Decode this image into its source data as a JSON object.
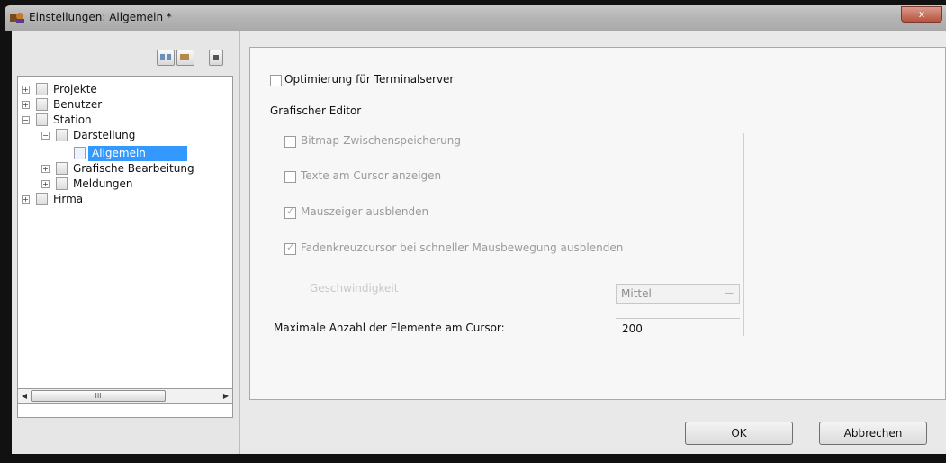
{
  "window": {
    "title": "Einstellungen: Allgemein *",
    "close_symbol": "x"
  },
  "toolbar": {
    "buttons": [
      "expand-all-icon",
      "collapse-all-icon",
      "options-icon"
    ]
  },
  "tree": {
    "items": [
      {
        "label": "Projekte",
        "expander": "+"
      },
      {
        "label": "Benutzer",
        "expander": "+"
      },
      {
        "label": "Station",
        "expander": "−"
      },
      {
        "label": "Darstellung",
        "expander": "−"
      },
      {
        "label": "Allgemein",
        "selected": true
      },
      {
        "label": "Grafische Bearbeitung",
        "expander": "+"
      },
      {
        "label": "Meldungen",
        "expander": "+"
      },
      {
        "label": "Firma",
        "expander": "+"
      }
    ],
    "scroll_thumb_text": "III"
  },
  "settings": {
    "terminalserver_label": "Optimierung für Terminalserver",
    "terminalserver_checked": false,
    "group_title": "Grafischer Editor",
    "bitmap_label": "Bitmap-Zwischenspeicherung",
    "bitmap_checked": false,
    "texte_label": "Texte am Cursor anzeigen",
    "texte_checked": false,
    "mauszeiger_label": "Mauszeiger ausblenden",
    "mauszeiger_checked": true,
    "fadenkreuz_label": "Fadenkreuzcursor bei schneller Mausbewegung ausblenden",
    "fadenkreuz_checked": true,
    "geschwindigkeit_label": "Geschwindigkeit",
    "geschwindigkeit_value": "Mittel",
    "max_label": "Maximale Anzahl der Elemente am Cursor:",
    "max_value": "200"
  },
  "buttons": {
    "ok": "OK",
    "cancel": "Abbrechen"
  }
}
